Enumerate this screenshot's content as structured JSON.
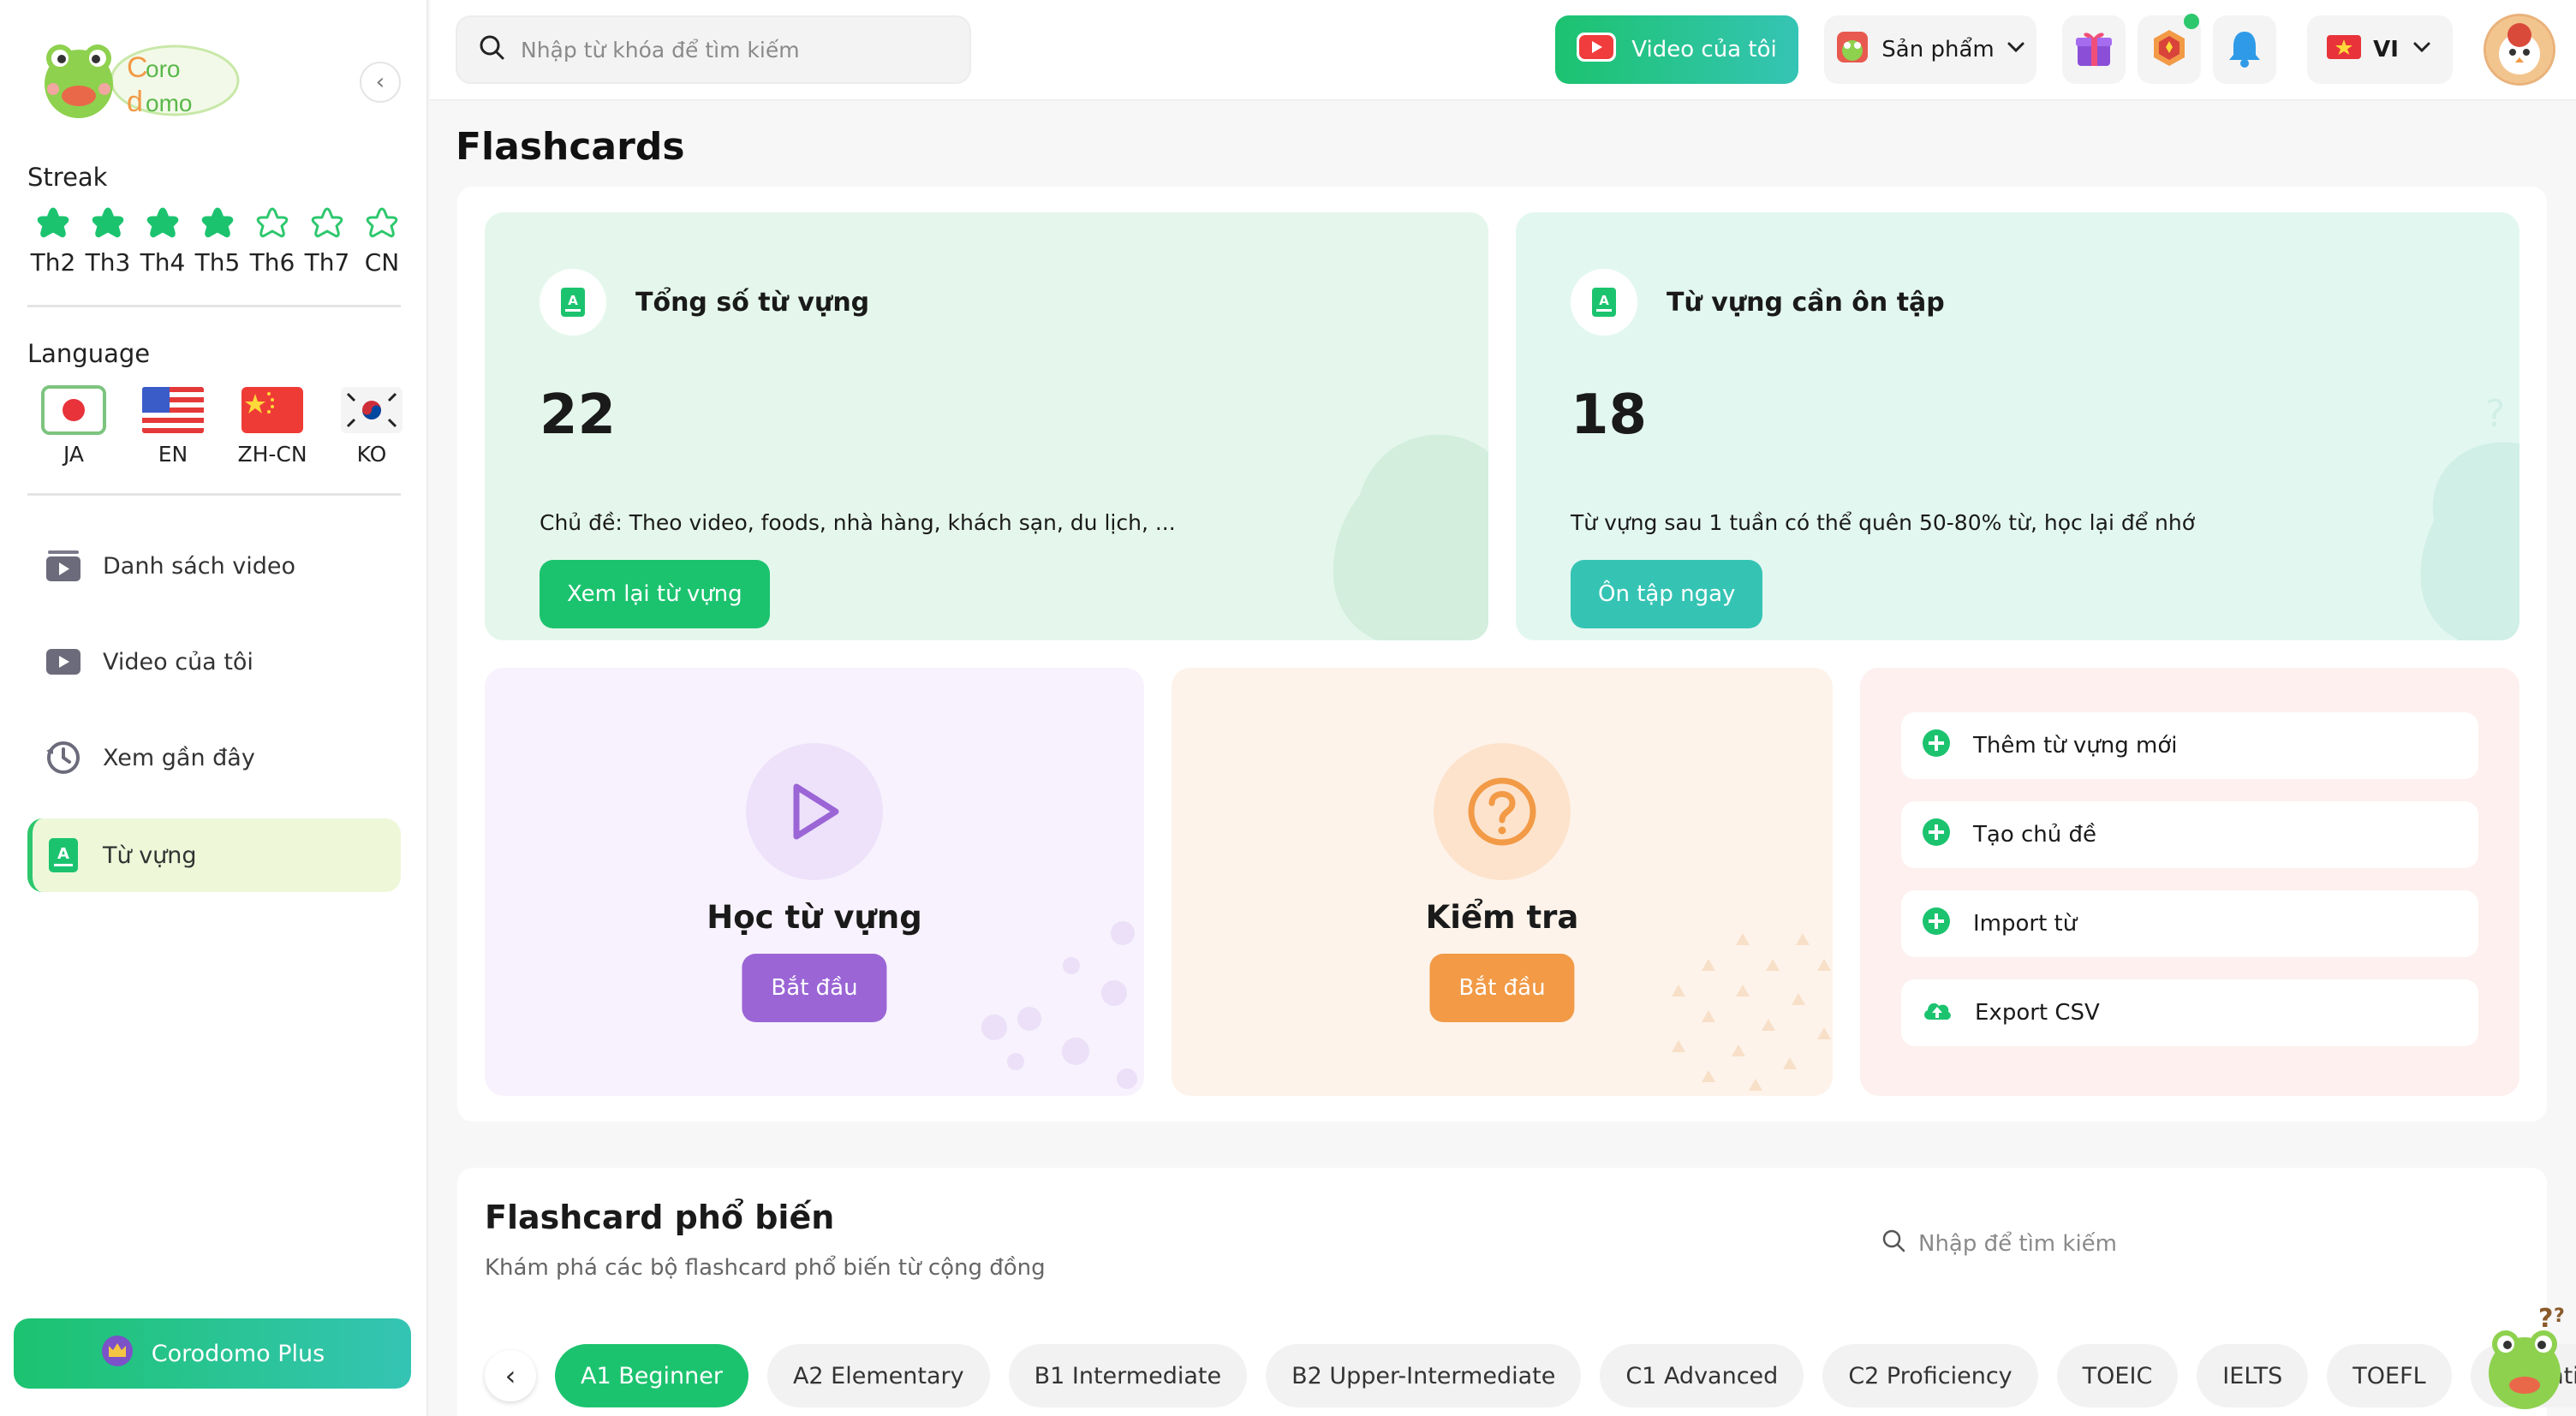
{
  "sidebar": {
    "logo_text_line1": "oro",
    "logo_text_line2": "omo",
    "streak": {
      "title": "Streak",
      "days": [
        {
          "label": "Th2",
          "done": true
        },
        {
          "label": "Th3",
          "done": true
        },
        {
          "label": "Th4",
          "done": true
        },
        {
          "label": "Th5",
          "done": true
        },
        {
          "label": "Th6",
          "done": false
        },
        {
          "label": "Th7",
          "done": false
        },
        {
          "label": "CN",
          "done": false
        }
      ]
    },
    "language": {
      "title": "Language",
      "options": [
        {
          "code": "JA",
          "icon": "japan-flag-icon",
          "active": true
        },
        {
          "code": "EN",
          "icon": "usa-flag-icon",
          "active": false
        },
        {
          "code": "ZH-CN",
          "icon": "china-flag-icon",
          "active": false
        },
        {
          "code": "KO",
          "icon": "korea-flag-icon",
          "active": false
        }
      ]
    },
    "nav": [
      {
        "label": "Danh sách video",
        "icon": "video-list-icon",
        "active": false
      },
      {
        "label": "Video của tôi",
        "icon": "video-icon",
        "active": false
      },
      {
        "label": "Xem gần đây",
        "icon": "history-icon",
        "active": false
      },
      {
        "label": "Từ vựng",
        "icon": "vocabulary-icon",
        "active": true
      }
    ],
    "plus_label": "Corodomo Plus"
  },
  "topbar": {
    "search_placeholder": "Nhập từ khóa để tìm kiếm",
    "my_video_label": "Video của tôi",
    "product_label": "Sản phẩm",
    "lang_label": "VI"
  },
  "main": {
    "title": "Flashcards",
    "stats": [
      {
        "title": "Tổng số từ vựng",
        "number": "22",
        "desc": "Chủ đề: Theo video, foods, nhà hàng, khách sạn, du lịch, ...",
        "button": "Xem lại từ vựng"
      },
      {
        "title": "Từ vựng cần ôn tập",
        "number": "18",
        "desc": "Từ vựng sau 1 tuần có thể quên 50-80% từ, học lại để nhớ",
        "button": "Ôn tập ngay"
      }
    ],
    "actions": [
      {
        "title": "Học từ vựng",
        "button": "Bắt đầu"
      },
      {
        "title": "Kiểm tra",
        "button": "Bắt đầu"
      }
    ],
    "quick_actions": [
      {
        "label": "Thêm từ vựng mới",
        "icon": "plus-circle-icon"
      },
      {
        "label": "Tạo chủ đề",
        "icon": "plus-circle-icon"
      },
      {
        "label": "Import từ",
        "icon": "plus-circle-icon"
      },
      {
        "label": "Export CSV",
        "icon": "cloud-upload-icon"
      }
    ]
  },
  "popular": {
    "title": "Flashcard phổ biến",
    "subtitle": "Khám phá các bộ flashcard phổ biến từ cộng đồng",
    "search_placeholder": "Nhập để tìm kiếm",
    "chips": [
      {
        "label": "A1 Beginner",
        "active": true
      },
      {
        "label": "A2 Elementary",
        "active": false
      },
      {
        "label": "B1 Intermediate",
        "active": false
      },
      {
        "label": "B2 Upper-Intermediate",
        "active": false
      },
      {
        "label": "C1 Advanced",
        "active": false
      },
      {
        "label": "C2 Proficiency",
        "active": false
      },
      {
        "label": "TOEIC",
        "active": false
      },
      {
        "label": "IELTS",
        "active": false
      },
      {
        "label": "TOEFL",
        "active": false
      },
      {
        "label": "Essential",
        "active": false
      }
    ]
  },
  "colors": {
    "brand_green": "#1cc36f",
    "teal": "#35c4b4",
    "purple": "#9b65d6",
    "orange": "#f29a46"
  }
}
